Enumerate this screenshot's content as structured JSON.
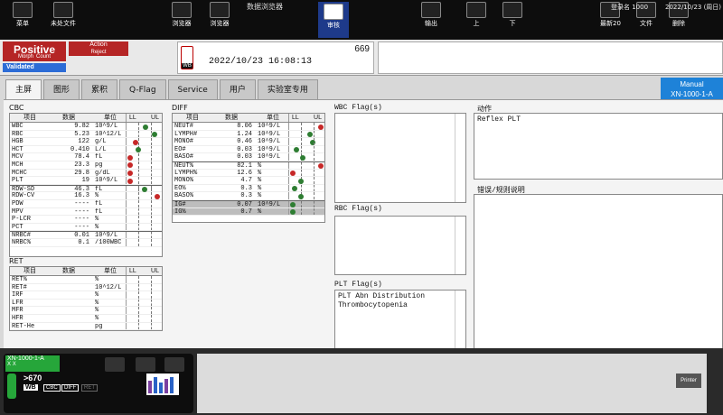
{
  "toolbar": {
    "window_title": "数据浏览器",
    "btn_menu": "菜单",
    "btn_unsaved": "未处文件",
    "btn_browser": "浏览器",
    "btn_explorer": "浏览器",
    "btn_review": "审核",
    "btn_export": "输出",
    "btn_up": "上",
    "btn_down": "下",
    "btn_latest": "最新20",
    "btn_file": "文件",
    "btn_delete": "删除",
    "login": "登录名 1000",
    "datetime": "2022/10/23 (周日)"
  },
  "status": {
    "positive": "Positive",
    "morph": "Morph",
    "count": "Count",
    "validated": "Validated",
    "action": "Action",
    "reject": "Reject"
  },
  "sample": {
    "number": "669",
    "type": "WB",
    "date": "2022/10/23 16:08:13"
  },
  "tabs": [
    "主屏",
    "图形",
    "累积",
    "Q-Flag",
    "Service",
    "用户",
    "实验室专用"
  ],
  "manual": {
    "mode": "Manual",
    "analyzer": "XN-1000-1-A"
  },
  "cbc": {
    "title": "CBC",
    "headers": [
      "项目",
      "数据",
      "单位",
      "LL",
      "UL"
    ],
    "rows": [
      {
        "name": "WBC",
        "value": "9.82",
        "unit": "10^9/L",
        "dot": 0.55,
        "color": "#2e7d32"
      },
      {
        "name": "RBC",
        "value": "5.23",
        "unit": "10^12/L",
        "dot": 0.85,
        "color": "#2e7d32"
      },
      {
        "name": "HGB",
        "value": "122",
        "unit": "g/L",
        "dot": 0.2,
        "color": "#c62828"
      },
      {
        "name": "HCT",
        "value": "0.410",
        "unit": "L/L",
        "dot": 0.3,
        "color": "#2e7d32"
      },
      {
        "name": "MCV",
        "value": "78.4",
        "unit": "fL",
        "dot": 0.02,
        "color": "#c62828"
      },
      {
        "name": "MCH",
        "value": "23.3",
        "unit": "pg",
        "dot": 0.02,
        "color": "#c62828"
      },
      {
        "name": "MCHC",
        "value": "29.8",
        "unit": "g/dL",
        "dot": 0.02,
        "color": "#c62828"
      },
      {
        "name": "PLT",
        "value": "19",
        "unit": "10^9/L",
        "dot": 0.02,
        "color": "#c62828"
      },
      {
        "name": "RDW-SD",
        "value": "46.3",
        "unit": "fL",
        "dot": 0.5,
        "color": "#2e7d32"
      },
      {
        "name": "RDW-CV",
        "value": "16.3",
        "unit": "%",
        "dot": 0.95,
        "color": "#c62828"
      },
      {
        "name": "PDW",
        "value": "----",
        "unit": "fL",
        "dot": null,
        "color": ""
      },
      {
        "name": "MPV",
        "value": "----",
        "unit": "fL",
        "dot": null,
        "color": ""
      },
      {
        "name": "P-LCR",
        "value": "----",
        "unit": "%",
        "dot": null,
        "color": ""
      },
      {
        "name": "PCT",
        "value": "----",
        "unit": "%",
        "dot": null,
        "color": ""
      },
      {
        "name": "NRBC#",
        "value": "0.01",
        "unit": "10^9/L",
        "dot": null,
        "color": ""
      },
      {
        "name": "NRBC%",
        "value": "0.1",
        "unit": "/100WBC",
        "dot": null,
        "color": ""
      }
    ]
  },
  "ret": {
    "title": "RET",
    "headers": [
      "项目",
      "数据",
      "单位",
      "LL",
      "UL"
    ],
    "rows": [
      {
        "name": "RET%",
        "value": "",
        "unit": "%"
      },
      {
        "name": "RET#",
        "value": "",
        "unit": "10^12/L"
      },
      {
        "name": "IRF",
        "value": "",
        "unit": "%"
      },
      {
        "name": "LFR",
        "value": "",
        "unit": "%"
      },
      {
        "name": "MFR",
        "value": "",
        "unit": "%"
      },
      {
        "name": "HFR",
        "value": "",
        "unit": "%"
      },
      {
        "name": "RET-He",
        "value": "",
        "unit": "pg"
      }
    ]
  },
  "diff": {
    "title": "DIFF",
    "headers": [
      "项目",
      "数据",
      "单位",
      "LL",
      "UL"
    ],
    "rows": [
      {
        "name": "NEUT#",
        "value": "8.06",
        "unit": "10^9/L",
        "dot": 0.98,
        "color": "#c62828"
      },
      {
        "name": "LYMPH#",
        "value": "1.24",
        "unit": "10^9/L",
        "dot": 0.6,
        "color": "#2e7d32"
      },
      {
        "name": "MONO#",
        "value": "0.46",
        "unit": "10^9/L",
        "dot": 0.7,
        "color": "#2e7d32"
      },
      {
        "name": "EO#",
        "value": "0.03",
        "unit": "10^9/L",
        "dot": 0.15,
        "color": "#2e7d32"
      },
      {
        "name": "BASO#",
        "value": "0.03",
        "unit": "10^9/L",
        "dot": 0.35,
        "color": "#2e7d32"
      },
      {
        "name": "NEUT%",
        "value": "82.1",
        "unit": "%",
        "dot": 0.98,
        "color": "#c62828"
      },
      {
        "name": "LYMPH%",
        "value": "12.6",
        "unit": "%",
        "dot": 0.02,
        "color": "#c62828"
      },
      {
        "name": "MONO%",
        "value": "4.7",
        "unit": "%",
        "dot": 0.3,
        "color": "#2e7d32"
      },
      {
        "name": "EO%",
        "value": "0.3",
        "unit": "%",
        "dot": 0.1,
        "color": "#2e7d32"
      },
      {
        "name": "BASO%",
        "value": "0.3",
        "unit": "%",
        "dot": 0.3,
        "color": "#2e7d32"
      },
      {
        "name": "IG#",
        "value": "0.07",
        "unit": "10^9/L",
        "dot": 0.02,
        "color": "#2e7d32"
      },
      {
        "name": "IG%",
        "value": "0.7",
        "unit": "%",
        "dot": 0.02,
        "color": "#2e7d32"
      }
    ]
  },
  "flags": {
    "wbc_title": "WBC Flag(s)",
    "rbc_title": "RBC Flag(s)",
    "plt_title": "PLT Flag(s)",
    "plt_line1": "PLT Abn Distribution",
    "plt_line2": "Thrombocytopenia"
  },
  "action": {
    "title": "动作",
    "text": "Reflex PLT"
  },
  "error": {
    "title": "错误/规则说明"
  },
  "bottom": {
    "analyzer": "XN-1000-1-A",
    "x1": "X",
    "x2": "X",
    "sample_no": ">670",
    "wb": "WB",
    "cbc": "CBC",
    "diff": "DIFF",
    "ret": "RET",
    "printer": "Printer"
  }
}
